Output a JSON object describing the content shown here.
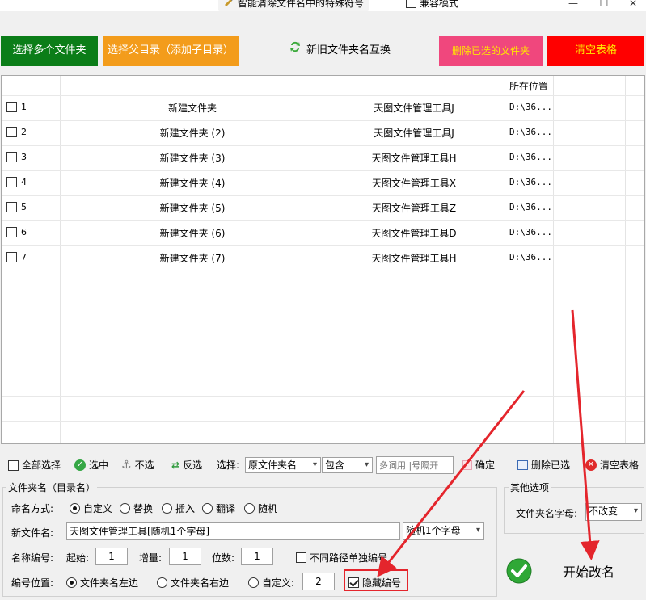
{
  "window": {
    "title": "智能清除文件名中的特殊符号",
    "compat_label": "兼容模式",
    "minimize": "—",
    "maximize": "☐",
    "close": "✕"
  },
  "toolbar": {
    "select_multi": "选择多个文件夹",
    "select_parent": "选择父目录（添加子目录）",
    "swap": "新旧文件夹名互换",
    "delete_selected": "删除已选的文件夹",
    "clear_table": "清空表格"
  },
  "table": {
    "location_header": "所在位置",
    "rows": [
      {
        "num": "1",
        "name": "新建文件夹",
        "new_name": "天图文件管理工具J",
        "location": "D:\\36..."
      },
      {
        "num": "2",
        "name": "新建文件夹 (2)",
        "new_name": "天图文件管理工具J",
        "location": "D:\\36..."
      },
      {
        "num": "3",
        "name": "新建文件夹 (3)",
        "new_name": "天图文件管理工具H",
        "location": "D:\\36..."
      },
      {
        "num": "4",
        "name": "新建文件夹 (4)",
        "new_name": "天图文件管理工具X",
        "location": "D:\\36..."
      },
      {
        "num": "5",
        "name": "新建文件夹 (5)",
        "new_name": "天图文件管理工具Z",
        "location": "D:\\36..."
      },
      {
        "num": "6",
        "name": "新建文件夹 (6)",
        "new_name": "天图文件管理工具D",
        "location": "D:\\36..."
      },
      {
        "num": "7",
        "name": "新建文件夹 (7)",
        "new_name": "天图文件管理工具H",
        "location": "D:\\36..."
      }
    ]
  },
  "selection_bar": {
    "select_all": "全部选择",
    "check": "选中",
    "uncheck": "不选",
    "invert": "反选",
    "filter_label": "选择:",
    "filter_field": "原文件夹名",
    "filter_mode": "包含",
    "filter_placeholder": "多词用 |号隔开",
    "confirm": "确定",
    "delete_checked": "删除已选",
    "clear_table": "清空表格"
  },
  "folder_name_group": {
    "title": "文件夹名（目录名）",
    "naming_label": "命名方式:",
    "naming_options": [
      "自定义",
      "替换",
      "插入",
      "翻译",
      "随机"
    ],
    "new_name_label": "新文件名:",
    "new_name_value": "天图文件管理工具[随机1个字母]",
    "new_name_dropdown": "随机1个字母",
    "numbering_label": "名称编号:",
    "start_label": "起始:",
    "start_value": "1",
    "step_label": "增量:",
    "step_value": "1",
    "digits_label": "位数:",
    "digits_value": "1",
    "separate_label": "不同路径单独编号",
    "position_label": "编号位置:",
    "position_left": "文件夹名左边",
    "position_right": "文件夹名右边",
    "position_custom": "自定义:",
    "custom_value": "2",
    "hide_number": "隐藏编号"
  },
  "other_group": {
    "title": "其他选项",
    "case_label": "文件夹名字母:",
    "case_value": "不改变"
  },
  "start_button": "开始改名",
  "colors": {
    "green_button": "#0b7d18",
    "orange_button": "#f39c1b",
    "pink_button": "#f0477d",
    "red_button": "#ff0000",
    "yellow_text": "#ffe600",
    "annotation_red": "#e4252c"
  }
}
